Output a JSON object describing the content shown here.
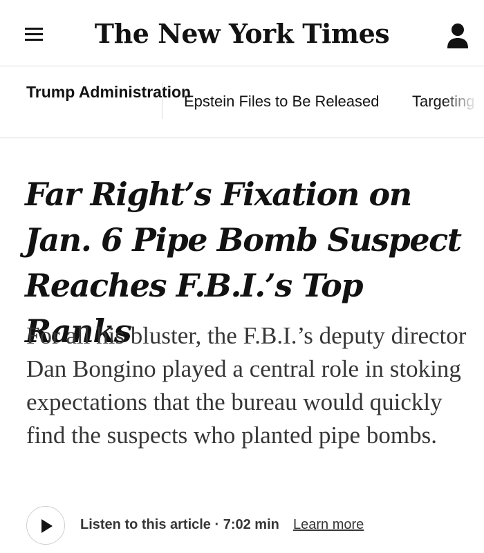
{
  "header": {
    "logo": "The New York Times",
    "menu_icon": "hamburger-menu-icon",
    "account_icon": "person-icon"
  },
  "section_nav": {
    "section_title": "Trump Administration",
    "links": [
      "Epstein Files to Be Released",
      "Targeting V"
    ]
  },
  "article": {
    "headline": "Far Right’s Fixation on Jan. 6 Pipe Bomb Suspect Reaches F.B.I.’s Top Ranks",
    "summary": "For all his bluster, the F.B.I.’s deputy director Dan Bongino played a central role in stoking expectations that the bureau would quickly find the suspects who planted pipe bombs.",
    "listen": {
      "label": "Listen to this article · 7:02 min",
      "learn_more": "Learn more",
      "play_icon": "play-icon"
    }
  }
}
